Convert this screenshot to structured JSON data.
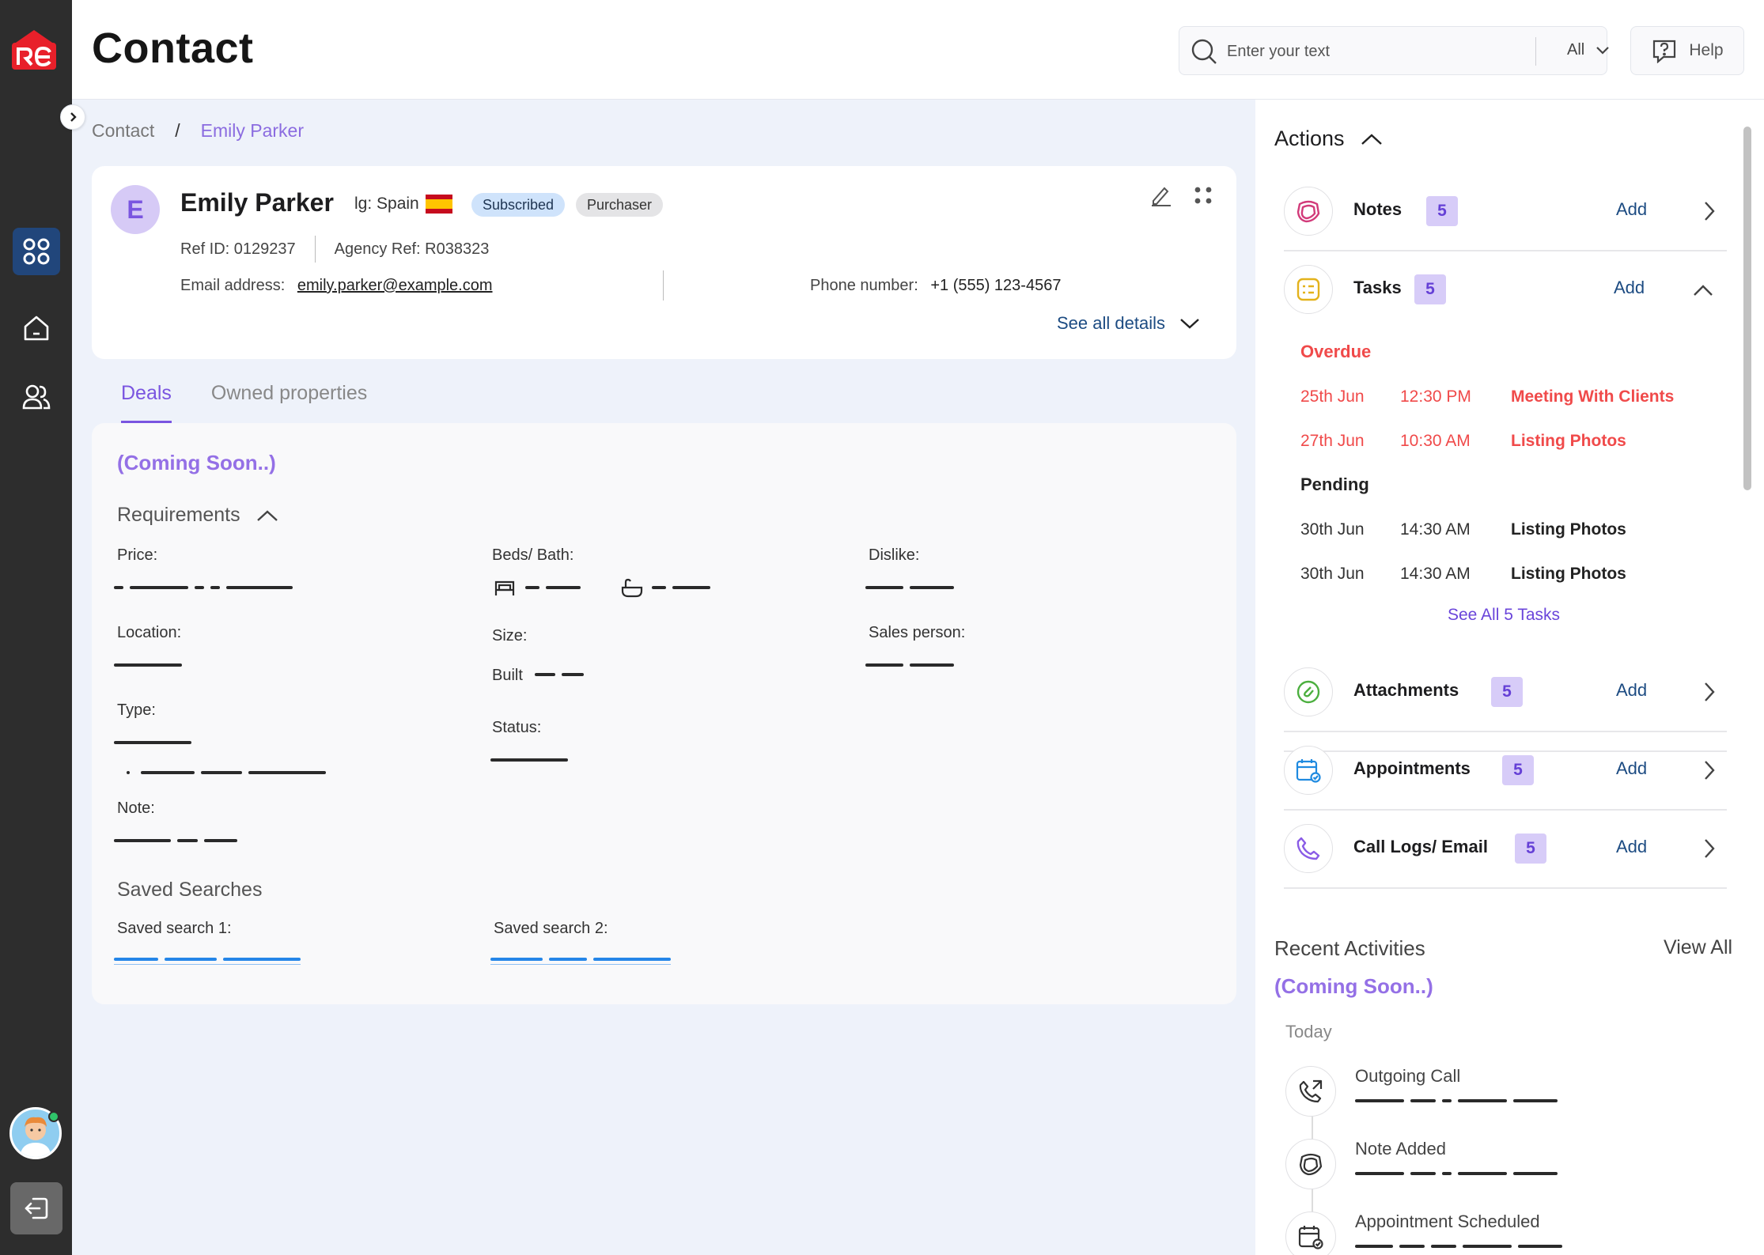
{
  "app": {
    "logo_text": "RE",
    "page_title": "Contact"
  },
  "search": {
    "placeholder": "Enter your text",
    "filter_value": "All"
  },
  "help": {
    "label": "Help"
  },
  "breadcrumb": {
    "root": "Contact",
    "separator": "/",
    "current": "Emily Parker"
  },
  "contact": {
    "initial": "E",
    "name": "Emily Parker",
    "language": "lg: Spain",
    "badges": [
      "Subscribed",
      "Purchaser"
    ],
    "ref_id": "Ref ID: 0129237",
    "agency_ref": "Agency Ref: R038323",
    "email_label": "Email address:",
    "email": "emily.parker@example.com",
    "phone_label": "Phone number:",
    "phone": "+1 (555) 123-4567",
    "see_all": "See all details"
  },
  "tabs": [
    "Deals",
    "Owned properties"
  ],
  "deals": {
    "coming_soon": "(Coming Soon..)",
    "requirements_title": "Requirements",
    "fields": {
      "price": "Price:",
      "beds_bath": "Beds/ Bath:",
      "dislike": "Dislike:",
      "location": "Location:",
      "size": "Size:",
      "size_built": "Built",
      "sales_person": "Sales person:",
      "type": "Type:",
      "status": "Status:",
      "note": "Note:"
    },
    "saved_searches_title": "Saved Searches",
    "saved_search_1": "Saved search 1:",
    "saved_search_2": "Saved search 2:"
  },
  "actions": {
    "title": "Actions",
    "add_label": "Add",
    "items": [
      {
        "label": "Notes",
        "count": "5"
      },
      {
        "label": "Tasks",
        "count": "5"
      },
      {
        "label": "Attachments",
        "count": "5"
      },
      {
        "label": "Appointments",
        "count": "5"
      },
      {
        "label": "Call Logs/ Email",
        "count": "5"
      }
    ],
    "tasks": {
      "overdue_title": "Overdue",
      "overdue": [
        {
          "date": "25th Jun",
          "time": "12:30 PM",
          "title": "Meeting With Clients"
        },
        {
          "date": "27th Jun",
          "time": "10:30 AM",
          "title": "Listing Photos"
        }
      ],
      "pending_title": "Pending",
      "pending": [
        {
          "date": "30th Jun",
          "time": "14:30 AM",
          "title": "Listing Photos"
        },
        {
          "date": "30th Jun",
          "time": "14:30 AM",
          "title": "Listing Photos"
        }
      ],
      "see_all": "See All 5 Tasks"
    }
  },
  "recent": {
    "title": "Recent Activities",
    "view_all": "View All",
    "coming_soon": "(Coming Soon..)",
    "today": "Today",
    "events": [
      "Outgoing Call",
      "Note Added",
      "Appointment Scheduled"
    ]
  },
  "colors": {
    "accent": "#7a55e0",
    "link": "#1c4b82",
    "overdue": "#f04a4a",
    "sidebar": "#2d2d2d"
  }
}
